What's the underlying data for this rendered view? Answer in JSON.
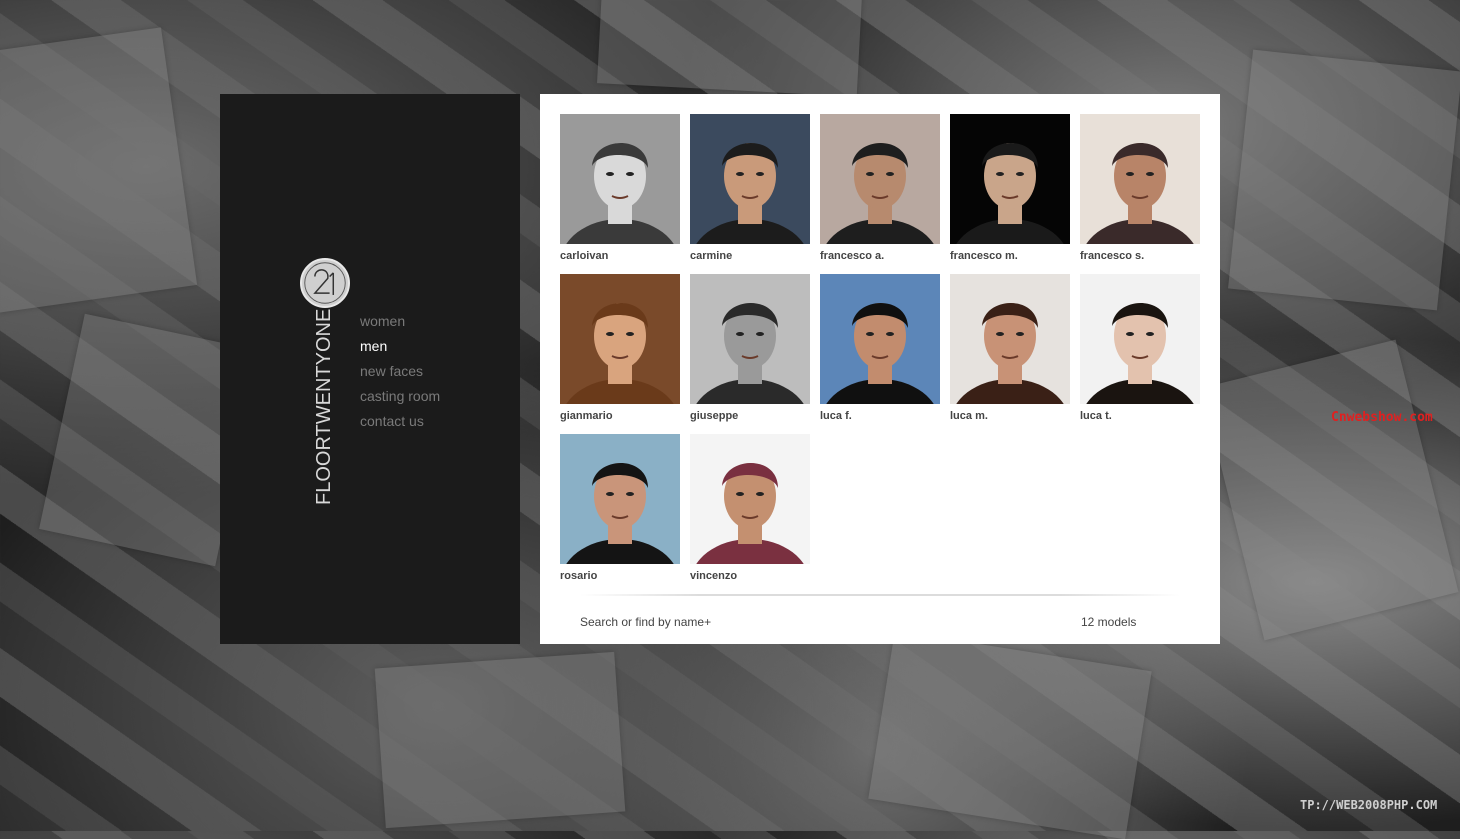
{
  "brand": {
    "logo_text": "FLOORTWENTYONE",
    "logo_digits": "21"
  },
  "nav": {
    "items": [
      {
        "label": "women",
        "active": false
      },
      {
        "label": "men",
        "active": true
      },
      {
        "label": "new faces",
        "active": false
      },
      {
        "label": "casting room",
        "active": false
      },
      {
        "label": "contact us",
        "active": false
      }
    ]
  },
  "models": [
    {
      "name": "carloivan"
    },
    {
      "name": "carmine"
    },
    {
      "name": "francesco a."
    },
    {
      "name": "francesco m."
    },
    {
      "name": "francesco s."
    },
    {
      "name": "gianmario"
    },
    {
      "name": "giuseppe"
    },
    {
      "name": "luca f."
    },
    {
      "name": "luca m."
    },
    {
      "name": "luca t."
    },
    {
      "name": "rosario"
    },
    {
      "name": "vincenzo"
    }
  ],
  "footer": {
    "search_label": "Search or find by name+",
    "count_label": "12 models"
  },
  "watermarks": {
    "red": "Cnwebshow.com",
    "grey": "TP://WEB2008PHP.COM"
  },
  "colors": {
    "panel_dark": "#1b1b1b",
    "nav_active": "#ffffff",
    "nav_inactive": "#7a7a7a"
  }
}
